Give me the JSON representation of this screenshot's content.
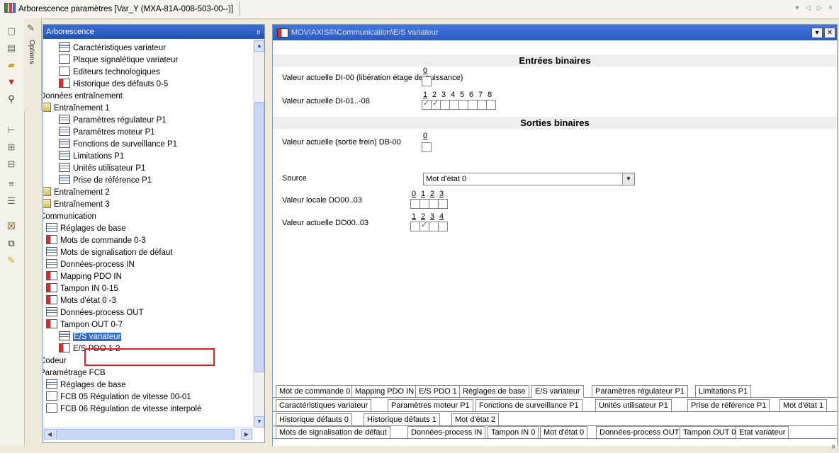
{
  "window": {
    "title": "Arborescence paramètres [Var_Y (MXA-81A-008-503-00--)]",
    "nav_arrows": "▾ ◁ ▷ ×"
  },
  "options": {
    "label": "Options"
  },
  "tree_panel": {
    "title": "Arborescence",
    "pin": "ᵖ",
    "items": [
      {
        "label": "Caractéristiques variateur",
        "icon": "screen"
      },
      {
        "label": "Plaque signalétique variateur",
        "icon": "doc"
      },
      {
        "label": "Editeurs technologiques",
        "icon": "doc"
      },
      {
        "label": "Historique des défauts 0-5",
        "icon": "red"
      },
      {
        "label": "Données entraînement",
        "icon": "folder",
        "expander": "−"
      },
      {
        "label": "Entraînement 1",
        "icon": "folder",
        "expander": "−"
      },
      {
        "label": "Paramètres régulateur P1",
        "icon": "screen"
      },
      {
        "label": "Paramètres moteur P1",
        "icon": "screen"
      },
      {
        "label": "Fonctions de surveillance P1",
        "icon": "screen"
      },
      {
        "label": "Limitations P1",
        "icon": "screen"
      },
      {
        "label": "Unités utilisateur P1",
        "icon": "screen"
      },
      {
        "label": "Prise de référence P1",
        "icon": "screen"
      },
      {
        "label": "Entraînement 2",
        "icon": "folder",
        "expander": "+"
      },
      {
        "label": "Entraînement 3",
        "icon": "folder",
        "expander": "+"
      },
      {
        "label": "Communication",
        "icon": "folder",
        "expander": "−"
      },
      {
        "label": "Réglages de base",
        "icon": "screen"
      },
      {
        "label": "Mots de commande 0-3",
        "icon": "red"
      },
      {
        "label": "Mots de signalisation de défaut",
        "icon": "screen"
      },
      {
        "label": "Données-process IN",
        "icon": "screen"
      },
      {
        "label": "Mapping PDO IN",
        "icon": "red"
      },
      {
        "label": "Tampon IN 0-15",
        "icon": "red"
      },
      {
        "label": "Mots d'état 0 -3",
        "icon": "red"
      },
      {
        "label": "Données-process OUT",
        "icon": "screen"
      },
      {
        "label": "Tampon OUT 0-7",
        "icon": "red"
      },
      {
        "label": "E/S variateur",
        "icon": "screen",
        "selected": true
      },
      {
        "label": "E/S PDO 1-2",
        "icon": "red"
      },
      {
        "label": "Codeur",
        "icon": "folder",
        "expander": "+"
      },
      {
        "label": "Paramétrage FCB",
        "icon": "folder",
        "expander": "−"
      },
      {
        "label": "Réglages de base",
        "icon": "screen"
      },
      {
        "label": "FCB 05 Régulation de vitesse 00-01",
        "icon": "doc"
      },
      {
        "label": "FCB 06 Régulation de vitesse interpolé",
        "icon": "doc"
      }
    ]
  },
  "main": {
    "path": "MOVIAXIS®\\Communication\\E/S variateur",
    "section_in": "Entrées binaires",
    "di00_label": "Valeur actuelle DI-00 (libération étage de puissance)",
    "di00_num": "0",
    "di00_checked": false,
    "di0108_label": "Valeur actuelle DI-01..-08",
    "di0108_nums": [
      "1",
      "2",
      "3",
      "4",
      "5",
      "6",
      "7",
      "8"
    ],
    "di0108_checked": [
      true,
      true,
      false,
      false,
      false,
      false,
      false,
      false
    ],
    "section_out": "Sorties binaires",
    "db00_label": "Valeur actuelle (sortie frein) DB-00",
    "db00_num": "0",
    "source_label": "Source",
    "source_value": "Mot d'état 0",
    "do_local_label": "Valeur locale DO00..03",
    "do_local_nums": [
      "0",
      "1",
      "2",
      "3"
    ],
    "do_actual_label": "Valeur actuelle DO00..03",
    "do_actual_nums": [
      "1",
      "2",
      "3",
      "4"
    ],
    "do_actual_checked": [
      false,
      true,
      false,
      false
    ]
  },
  "tab_rows": [
    [
      "Mot de commande 0",
      "Mapping PDO IN",
      "E/S PDO 1",
      "Réglages de base",
      "E/S variateur",
      "Paramètres régulateur P1",
      "Limitations P1"
    ],
    [
      "Caractéristiques variateur",
      "Paramètres moteur P1",
      "Fonctions de surveillance P1",
      "Unités utilisateur P1",
      "Prise de référence P1",
      "Mot d'état 1"
    ],
    [
      "Historique défauts 0",
      "Historique défauts 1",
      "Mot d'état 2"
    ],
    [
      "Mots de signalisation de défaut",
      "Données-process IN",
      "Tampon IN 0",
      "Mot d'état 0",
      "Données-process OUT",
      "Tampon OUT 0",
      "Etat variateur"
    ]
  ],
  "active_tab": "E/S variateur",
  "colors": {
    "selection": "#316ac5",
    "panel_header": "#2a59c2",
    "highlight_box": "#e02020"
  }
}
